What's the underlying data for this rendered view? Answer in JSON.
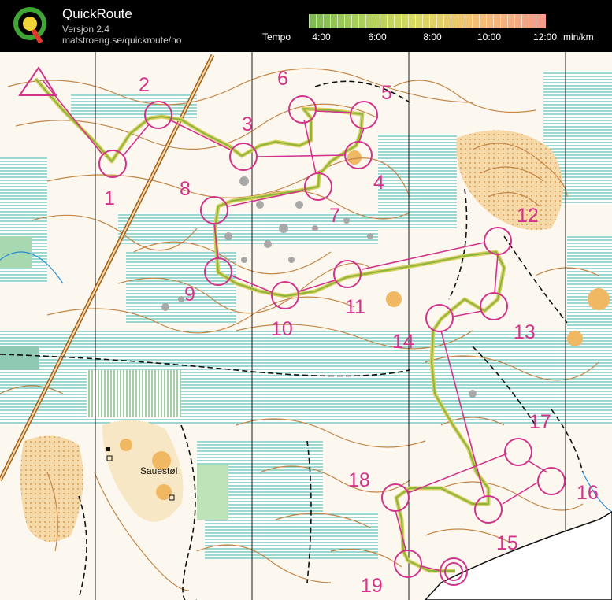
{
  "app": {
    "title": "QuickRoute",
    "version": "Versjon 2.4",
    "url": "matstroeng.se/quickroute/no"
  },
  "legend": {
    "label": "Tempo",
    "ticks": [
      "4:00",
      "6:00",
      "8:00",
      "10:00",
      "12:00"
    ],
    "unit": "min/km",
    "colors": [
      "#7ab850",
      "#d8d860",
      "#f59a8c"
    ]
  },
  "map": {
    "place_name": "Sauestøl",
    "course_color": "#d1338a",
    "route_color": "#8db43c",
    "controls": [
      "1",
      "2",
      "3",
      "4",
      "5",
      "6",
      "7",
      "8",
      "9",
      "10",
      "11",
      "12",
      "13",
      "14",
      "15",
      "16",
      "17",
      "18",
      "19"
    ]
  }
}
